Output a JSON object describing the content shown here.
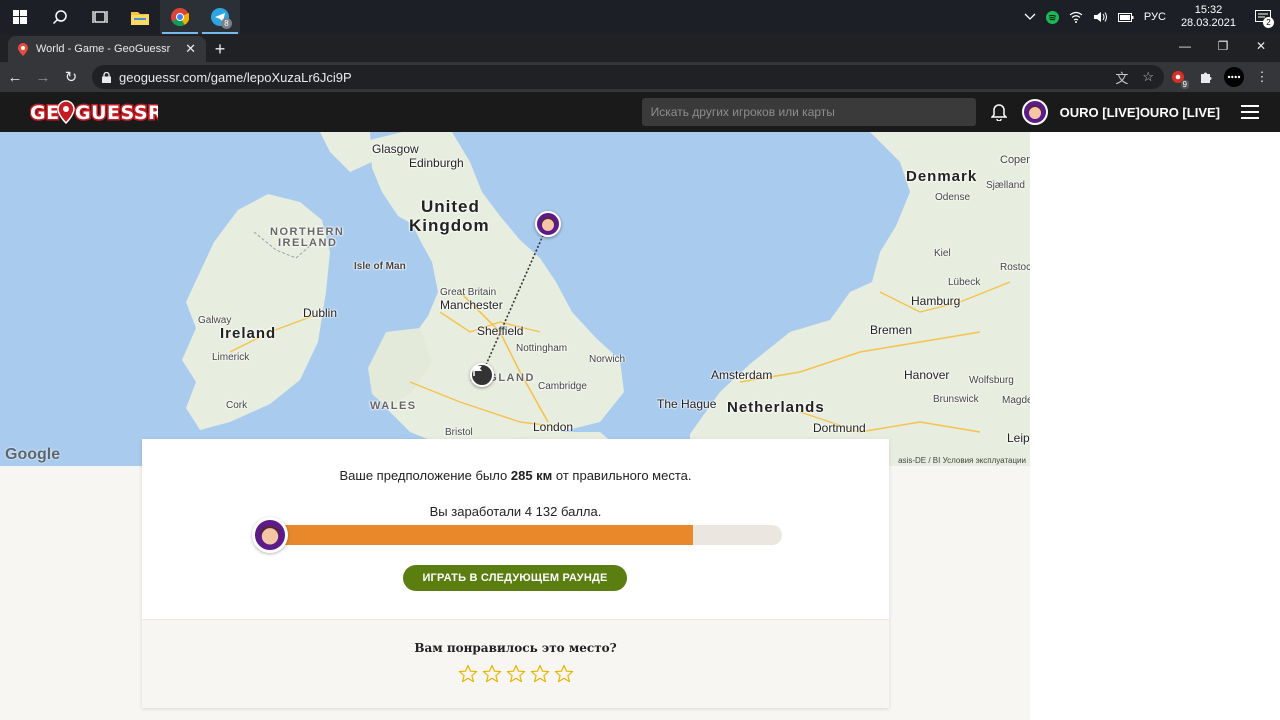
{
  "taskbar": {
    "language": "РУС",
    "time": "15:32",
    "date": "28.03.2021",
    "notification_count": "2",
    "telegram_badge": "8",
    "icons": [
      "windows-icon",
      "search-icon",
      "task-view-icon",
      "file-explorer-icon",
      "chrome-icon",
      "telegram-icon"
    ]
  },
  "browser": {
    "tab_title": "World - Game - GeoGuessr",
    "url": "geoguessr.com/game/lepoXuzaLr6Jci9P",
    "extension_badge": "9"
  },
  "header": {
    "logo": "GEOGUESSR",
    "search_placeholder": "Искать других игроков или карты",
    "username": "OURO [LIVE]OURO [LIVE]"
  },
  "map": {
    "labels": {
      "glasgow": "Glasgow",
      "edinburgh": "Edinburgh",
      "uk_line1": "United",
      "uk_line2": "Kingdom",
      "isle_of_man": "Isle of Man",
      "northern_ireland_1": "NORTHERN",
      "northern_ireland_2": "IRELAND",
      "dublin": "Dublin",
      "ireland": "Ireland",
      "galway": "Galway",
      "limerick": "Limerick",
      "cork": "Cork",
      "great_britain": "Great Britain",
      "manchester": "Manchester",
      "sheffield": "Sheffield",
      "nottingham": "Nottingham",
      "norwich": "Norwich",
      "england": "ENGLAND",
      "cambridge": "Cambridge",
      "wales": "WALES",
      "bristol": "Bristol",
      "london": "London",
      "denmark": "Denmark",
      "copenhagen": "Copen",
      "sjaelland": "Sjælland",
      "odense": "Odense",
      "kiel": "Kiel",
      "lubeck": "Lübeck",
      "rostock": "Rostoc",
      "hamburg": "Hamburg",
      "bremen": "Bremen",
      "amsterdam": "Amsterdam",
      "hanover": "Hanover",
      "wolfsburg": "Wolfsburg",
      "the_hague": "The Hague",
      "netherlands": "Netherlands",
      "brunswick": "Brunswick",
      "magdeburg": "Magde",
      "dortmund": "Dortmund",
      "leipzig": "Leip"
    },
    "google_logo": "Google",
    "attribution": "asis-DE / BI  Условия эксплуатации"
  },
  "result": {
    "guess_prefix": "Ваше предположение было",
    "distance": "285 км",
    "guess_suffix": "от правильного места.",
    "score_text": "Вы заработали 4 132 балла.",
    "score_fraction": 0.8264,
    "next_button": "ИГРАТЬ В СЛЕДУЮЩЕМ РАУНДЕ"
  },
  "rating": {
    "question": "Вам понравилось это место?",
    "stars": 5,
    "star_icon": "star-outline-icon",
    "star_color": "#e8b400"
  },
  "colors": {
    "progress_fill": "#e8882b",
    "button_green": "#5a7e10",
    "avatar_purple": "#5c1a8a"
  }
}
